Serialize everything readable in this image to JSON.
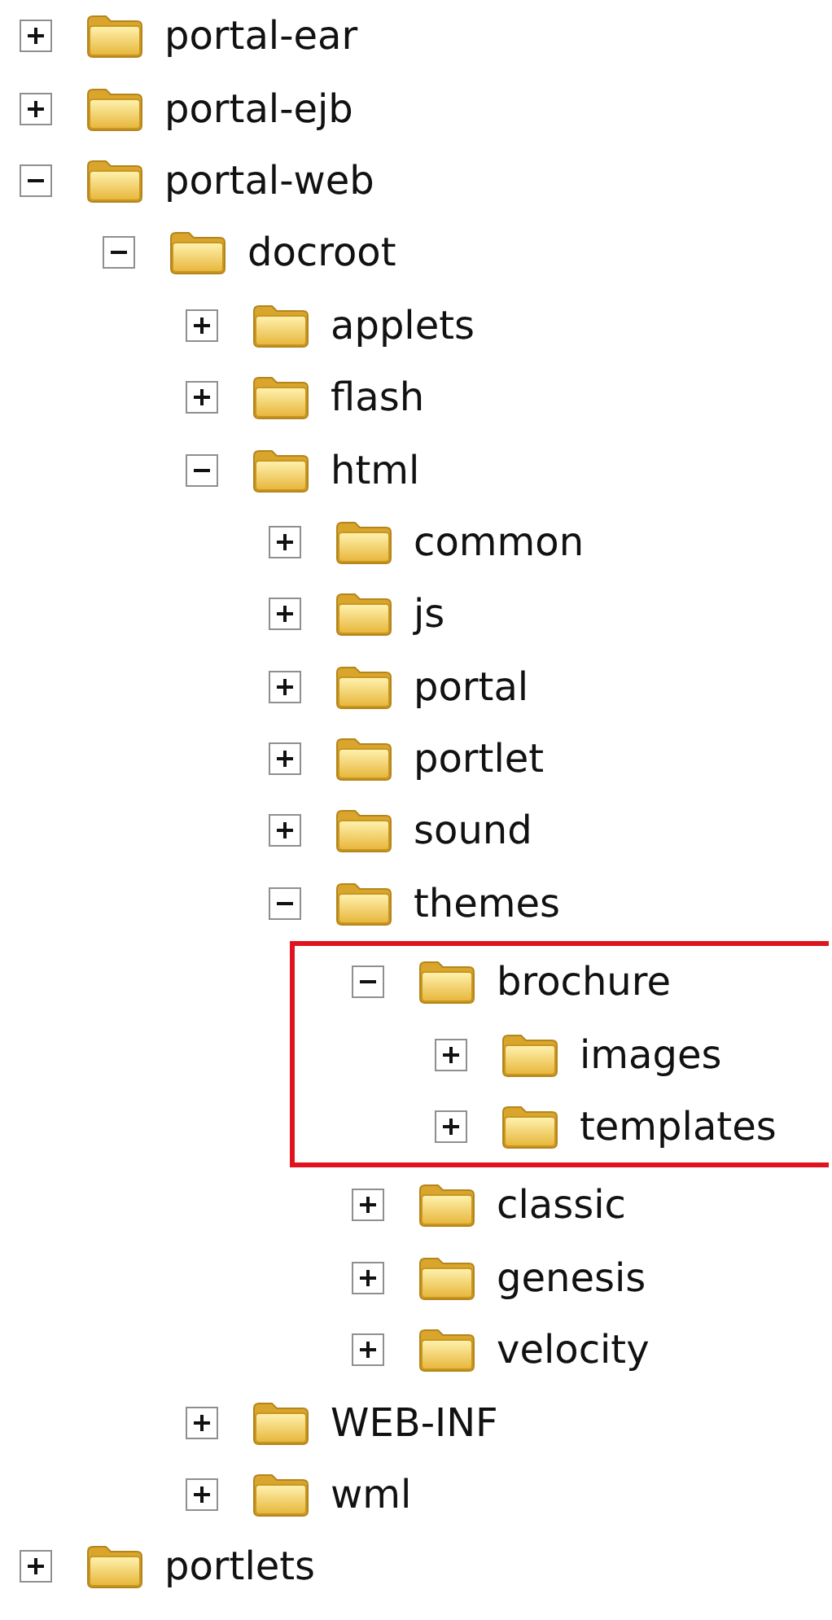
{
  "tree": [
    {
      "label": "portal-ear",
      "expanded": false
    },
    {
      "label": "portal-ejb",
      "expanded": false
    },
    {
      "label": "portal-web",
      "expanded": true,
      "children": [
        {
          "label": "docroot",
          "expanded": true,
          "children": [
            {
              "label": "applets",
              "expanded": false
            },
            {
              "label": "flash",
              "expanded": false
            },
            {
              "label": "html",
              "expanded": true,
              "children": [
                {
                  "label": "common",
                  "expanded": false
                },
                {
                  "label": "js",
                  "expanded": false
                },
                {
                  "label": "portal",
                  "expanded": false
                },
                {
                  "label": "portlet",
                  "expanded": false
                },
                {
                  "label": "sound",
                  "expanded": false
                },
                {
                  "label": "themes",
                  "expanded": true,
                  "children": [
                    {
                      "label": "brochure",
                      "expanded": true,
                      "highlighted": true,
                      "children": [
                        {
                          "label": "images",
                          "expanded": false
                        },
                        {
                          "label": "templates",
                          "expanded": false
                        }
                      ]
                    },
                    {
                      "label": "classic",
                      "expanded": false
                    },
                    {
                      "label": "genesis",
                      "expanded": false
                    },
                    {
                      "label": "velocity",
                      "expanded": false
                    }
                  ]
                }
              ]
            },
            {
              "label": "WEB-INF",
              "expanded": false
            },
            {
              "label": "wml",
              "expanded": false
            }
          ]
        }
      ]
    },
    {
      "label": "portlets",
      "expanded": false
    }
  ]
}
